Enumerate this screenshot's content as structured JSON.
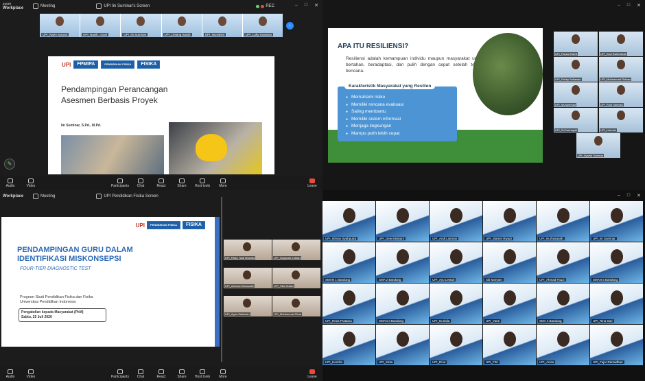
{
  "colors": {
    "accent": "#2d8cff",
    "leave": "#e74c3c",
    "slide_blue": "#2b69b6"
  },
  "q1": {
    "brand_top": "zoom",
    "brand_bottom": "Workplace",
    "tab1": "Meeting",
    "tab2": "UPI Iin Suminar's Screen",
    "rec": "REC",
    "strip": [
      "UPI_Naen Suryan",
      "UPI_Nanik...ryani",
      "UPI_Iin Suminar",
      "UPI_Lintang Sarah",
      "UPI_Nurrahim",
      "UPI_Luky Suwanto"
    ],
    "slide": {
      "logos": [
        "UPI",
        "FPMIPA",
        "PENDIDIKAN FISIKA",
        "FISIKA"
      ],
      "title": "Pendampingan Perancangan Asesmen Berbasis Proyek",
      "author": "Iin Suminar, S.Pd., M.Pd."
    },
    "toolbar": [
      "Audio",
      "Video",
      "Participants",
      "Chat",
      "React",
      "Share",
      "Host tools",
      "More",
      "Leave"
    ],
    "participants_count": "129"
  },
  "q2": {
    "slide": {
      "title": "APA ITU RESILIENSI?",
      "text": "Resiliensi adalah kemampuan individu maupun masyarakat untuk bertahan, beradaptasi, dan pulih dengan cepat setelah terjadi bencana.",
      "box_heading": "Karakteristik Masyarakat yang Resilien",
      "items": [
        "Memahami risiko",
        "Memiliki rencana evakuasi",
        "Saling membantu",
        "Memiliki sistem informasi",
        "Menjaga lingkungan",
        "Mampu pulih lebih cepat"
      ]
    },
    "grid": [
      "UPI_Fauzia Ramli",
      "UPI_Suci Rahmawati",
      "UPI_Febby Setiawan",
      "UPI_Muhammad Ridwan",
      "UPI_Muhammad",
      "UPI_Rudi Santoso",
      "UPI_Sri Nurhayati",
      "UPI_Lukman",
      "UPI_Syahid Suminar"
    ]
  },
  "q3": {
    "brand_bottom": "Workplace",
    "tab1": "Meeting",
    "tab2": "UPI Pendidikan Fisika Screen",
    "slide": {
      "logos": [
        "UPI",
        "PENDIDIKAN FISIKA",
        "FISIKA"
      ],
      "title": "PENDAMPINGAN GURU DALAM IDENTIFIKASI MISKONSEPSI",
      "subtitle": "FOUR-TIER DIAGNOSTIC TEST",
      "program": "Program Studi Pendidikan Fisika dan Fisika Universitas Pendidikan Indonesia",
      "event": "Pengabdian kepada Masyarakat (PkM)",
      "date": "Sabtu, 25 Juli 2026"
    },
    "grid": [
      "UPI_Rizky Hadi Mustofa",
      "UPI_Nurjanah Indriani",
      "UPI_Achmad Samsudin",
      "UPI_Hilal Sulton",
      "UPI_Agus Setiawan",
      "UPI_Muhammad Rizal"
    ],
    "toolbar": [
      "Audio",
      "Video",
      "Participants",
      "Chat",
      "React",
      "Share",
      "Host tools",
      "More",
      "Leave"
    ],
    "participants_count": "128"
  },
  "q4": {
    "grid": [
      "UPI_Ikhsan Syahputra",
      "UPI_Dewi Mulyani",
      "UPI_Andi Lukman",
      "UPI_Slamet Riyadi",
      "UPI_Nurhasanah",
      "UPI_Iin Suminar",
      "SMAN 1 Bandung",
      "SMA 2 Bandung",
      "UPI_Ayu Lestari",
      "Siti Maryam",
      "UPI_Ahmad Fauzi",
      "SMAN 5 Bandung",
      "UPI_Reza Pratama",
      "SMAN 3 Bandung",
      "UPI_Nurlaila",
      "UPI_Yanti",
      "SMA 4 Bandung",
      "UPI_Rina Sari",
      "UPI_Hendra",
      "UPI_Sinta",
      "UPI_Dina",
      "UPI_Fitri",
      "UPI_Anisa",
      "UPI_Fajar Ramadhan"
    ]
  }
}
